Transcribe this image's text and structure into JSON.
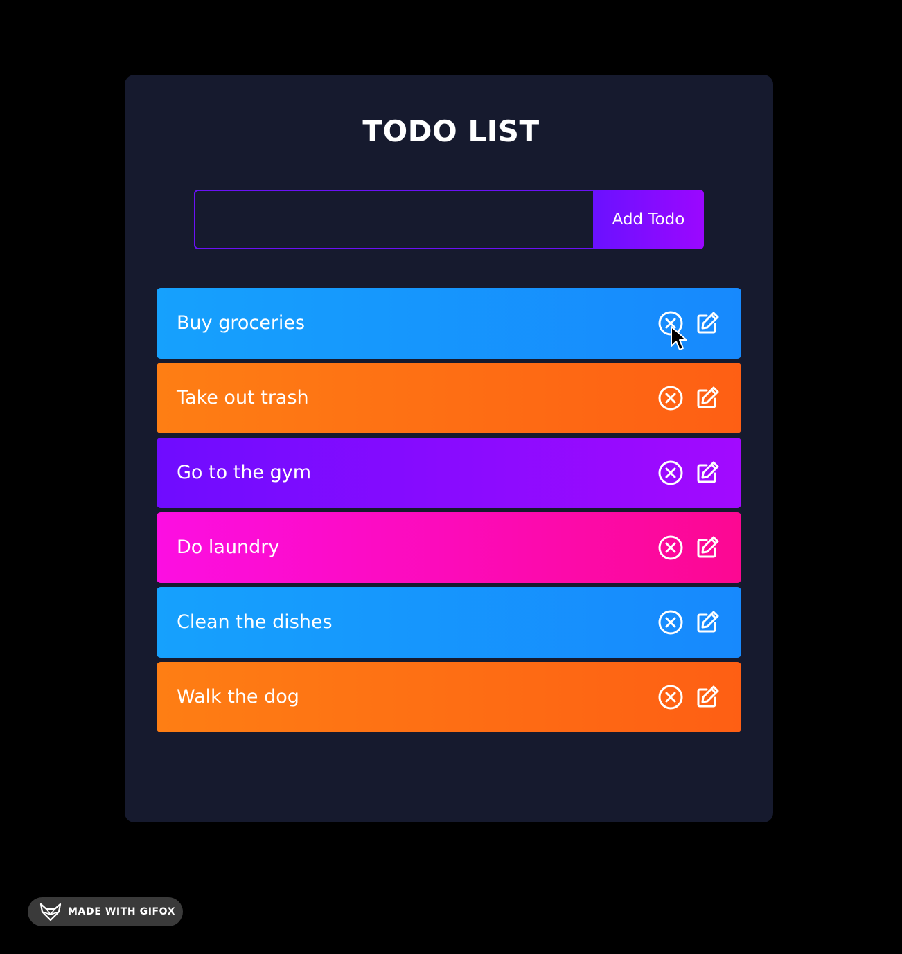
{
  "app": {
    "title": "TODO LIST"
  },
  "form": {
    "input_value": "",
    "input_placeholder": "",
    "add_label": "Add Todo"
  },
  "todos": [
    {
      "text": "Buy groceries",
      "color": "blue"
    },
    {
      "text": "Take out trash",
      "color": "orange"
    },
    {
      "text": "Go to the gym",
      "color": "purple"
    },
    {
      "text": "Do laundry",
      "color": "pink"
    },
    {
      "text": "Clean the dishes",
      "color": "blue"
    },
    {
      "text": "Walk the dog",
      "color": "orange"
    }
  ],
  "icons": {
    "delete": "close-circle-icon",
    "edit": "edit-icon"
  },
  "colors": {
    "background": "#000000",
    "card": "#161a2e",
    "accent_purple": "#6a11ff",
    "blue": "#16a1fd",
    "orange": "#fe7e14",
    "purple": "#6f0cff",
    "pink": "#fc0ee2"
  },
  "watermark": {
    "text": "MADE WITH GIFOX"
  }
}
